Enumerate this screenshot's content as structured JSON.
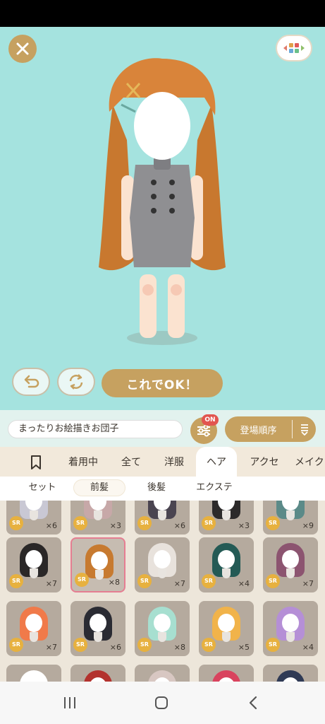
{
  "game": {
    "ok_button": "これでOK！",
    "name_value": "まったりお絵描きお団子",
    "filter_badge": "ON",
    "sort_label": "登場順序",
    "tabs": [
      "着用中",
      "全て",
      "洋服",
      "ヘア",
      "アクセ",
      "メイク"
    ],
    "active_tab": "ヘア",
    "subtabs": [
      "セット",
      "前髪",
      "後髪",
      "エクステ"
    ],
    "selected_subtab": "前髪"
  },
  "items": [
    {
      "rarity": "SR",
      "count": "×6",
      "hair": "#c9c8d4"
    },
    {
      "rarity": "SR",
      "count": "×3",
      "hair": "#c7a8a8"
    },
    {
      "rarity": "SR",
      "count": "×6",
      "hair": "#4a4450"
    },
    {
      "rarity": "SR",
      "count": "×3",
      "hair": "#2c2a2a"
    },
    {
      "rarity": "SR",
      "count": "×9",
      "hair": "#5b8a88"
    },
    {
      "rarity": "SR",
      "count": "×7",
      "hair": "#2a2727"
    },
    {
      "rarity": "SR",
      "count": "×8",
      "hair": "#c77a30"
    },
    {
      "rarity": "SR",
      "count": "×7",
      "hair": "#e8e2dc"
    },
    {
      "rarity": "SR",
      "count": "×4",
      "hair": "#245a55"
    },
    {
      "rarity": "SR",
      "count": "×7",
      "hair": "#8c5470"
    },
    {
      "rarity": "SR",
      "count": "×7",
      "hair": "#f07a4a"
    },
    {
      "rarity": "SR",
      "count": "×6",
      "hair": "#2a2b33"
    },
    {
      "rarity": "SR",
      "count": "×8",
      "hair": "#a7dfd0"
    },
    {
      "rarity": "SR",
      "count": "×5",
      "hair": "#f1b34a"
    },
    {
      "rarity": "SR",
      "count": "×4",
      "hair": "#b58fd6"
    },
    {
      "rarity": "",
      "count": "",
      "hair": "#ffffff"
    },
    {
      "rarity": "",
      "count": "",
      "hair": "#b3322e"
    },
    {
      "rarity": "",
      "count": "",
      "hair": "#d8c7c2"
    },
    {
      "rarity": "",
      "count": "",
      "hair": "#d9435e"
    },
    {
      "rarity": "",
      "count": "",
      "hair": "#2f3a55"
    }
  ],
  "colors": {
    "accent": "#c6a160",
    "background": "#a5e3df",
    "badge": "#e2554f",
    "sr": "#e7b13f"
  },
  "icons": [
    "close-icon",
    "layout-icon",
    "undo-icon",
    "randomize-icon",
    "filter-icon",
    "sort-icon",
    "bookmark-icon",
    "recent-apps-icon",
    "home-icon",
    "back-icon"
  ]
}
